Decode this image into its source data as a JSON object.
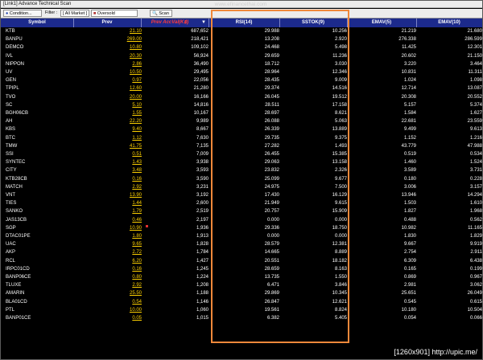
{
  "window": {
    "title": "[Link1] Advance Technical Scan",
    "watermark": "www.efinancethai.com"
  },
  "toolbar": {
    "condition_label": "Condition...",
    "filter_label": "Filter :",
    "filter_value": "[ All Market ]",
    "scan_name": "Oversold",
    "scan_label": "Scan"
  },
  "columns": {
    "symbol": "Symbol",
    "prev": "Prev",
    "prev_acc_val": "Prev AccVal(K฿)",
    "rsi": "RSI(14)",
    "sstok": "SSTOK(9)",
    "emav5": "EMAV(5)",
    "emav10": "EMAV(10)"
  },
  "rows": [
    {
      "symbol": "KTB",
      "prev": "21.10",
      "acc": "687,652",
      "rsi": "29.988",
      "ssto": "10.256",
      "ema5": "21.219",
      "ema10": "21.680"
    },
    {
      "symbol": "BANPU",
      "prev": "269.00",
      "acc": "218,421",
      "rsi": "13.208",
      "ssto": "2.920",
      "ema5": "276.338",
      "ema10": "286.599"
    },
    {
      "symbol": "DEMCO",
      "prev": "10.80",
      "acc": "109,102",
      "rsi": "24.468",
      "ssto": "5.498",
      "ema5": "11.425",
      "ema10": "12.301"
    },
    {
      "symbol": "IVL",
      "prev": "20.30",
      "acc": "56,924",
      "rsi": "29.659",
      "ssto": "11.236",
      "ema5": "20.602",
      "ema10": "21.150"
    },
    {
      "symbol": "NIPPON",
      "prev": "2.86",
      "acc": "36,490",
      "rsi": "18.712",
      "ssto": "3.030",
      "ema5": "3.220",
      "ema10": "3.464"
    },
    {
      "symbol": "UV",
      "prev": "10.50",
      "acc": "29,495",
      "rsi": "28.964",
      "ssto": "12.346",
      "ema5": "10.831",
      "ema10": "11.311"
    },
    {
      "symbol": "GEN",
      "prev": "0.97",
      "acc": "22,056",
      "rsi": "28.435",
      "ssto": "9.009",
      "ema5": "1.024",
      "ema10": "1.098"
    },
    {
      "symbol": "TPIPL",
      "prev": "12.60",
      "acc": "21,280",
      "rsi": "29.374",
      "ssto": "14.516",
      "ema5": "12.714",
      "ema10": "13.087"
    },
    {
      "symbol": "TVO",
      "prev": "20.00",
      "acc": "16,166",
      "rsi": "26.045",
      "ssto": "19.512",
      "ema5": "20.308",
      "ema10": "20.552"
    },
    {
      "symbol": "SC",
      "prev": "5.10",
      "acc": "14,816",
      "rsi": "28.511",
      "ssto": "17.158",
      "ema5": "5.157",
      "ema10": "5.374"
    },
    {
      "symbol": "BGH06CB",
      "prev": "1.55",
      "acc": "10,167",
      "rsi": "28.697",
      "ssto": "8.621",
      "ema5": "1.584",
      "ema10": "1.627"
    },
    {
      "symbol": "AH",
      "prev": "22.20",
      "acc": "9,989",
      "rsi": "26.088",
      "ssto": "5.063",
      "ema5": "22.681",
      "ema10": "23.559"
    },
    {
      "symbol": "KBS",
      "prev": "9.40",
      "acc": "8,667",
      "rsi": "26.339",
      "ssto": "13.889",
      "ema5": "9.499",
      "ema10": "9.613"
    },
    {
      "symbol": "BTC",
      "prev": "1.12",
      "acc": "7,630",
      "rsi": "29.735",
      "ssto": "9.375",
      "ema5": "1.152",
      "ema10": "1.216"
    },
    {
      "symbol": "TMW",
      "prev": "41.75",
      "acc": "7,135",
      "rsi": "27.282",
      "ssto": "1.493",
      "ema5": "43.779",
      "ema10": "47.988"
    },
    {
      "symbol": "SSI",
      "prev": "0.51",
      "acc": "7,009",
      "rsi": "26.455",
      "ssto": "15.385",
      "ema5": "0.519",
      "ema10": "0.534"
    },
    {
      "symbol": "SYNTEC",
      "prev": "1.43",
      "acc": "3,938",
      "rsi": "29.063",
      "ssto": "13.158",
      "ema5": "1.460",
      "ema10": "1.524"
    },
    {
      "symbol": "CITY",
      "prev": "3.48",
      "acc": "3,593",
      "rsi": "23.832",
      "ssto": "2.326",
      "ema5": "3.589",
      "ema10": "3.731"
    },
    {
      "symbol": "KTB28CB",
      "prev": "0.16",
      "acc": "3,590",
      "rsi": "25.099",
      "ssto": "9.677",
      "ema5": "0.180",
      "ema10": "0.228"
    },
    {
      "symbol": "MATCH",
      "prev": "2.92",
      "acc": "3,231",
      "rsi": "24.975",
      "ssto": "7.500",
      "ema5": "3.006",
      "ema10": "3.157"
    },
    {
      "symbol": "VNT",
      "prev": "13.90",
      "acc": "3,192",
      "rsi": "17.430",
      "ssto": "16.129",
      "ema5": "13.946",
      "ema10": "14.294"
    },
    {
      "symbol": "TIES",
      "prev": "1.44",
      "acc": "2,600",
      "rsi": "21.949",
      "ssto": "9.615",
      "ema5": "1.503",
      "ema10": "1.610"
    },
    {
      "symbol": "SANKO",
      "prev": "1.79",
      "acc": "2,519",
      "rsi": "20.757",
      "ssto": "15.909",
      "ema5": "1.827",
      "ema10": "1.968"
    },
    {
      "symbol": "JAS13CB",
      "prev": "0.46",
      "acc": "2,197",
      "rsi": "0.000",
      "ssto": "0.000",
      "ema5": "0.488",
      "ema10": "0.562"
    },
    {
      "symbol": "SGP",
      "prev": "10.90",
      "acc": "1,936",
      "rsi": "29.336",
      "ssto": "18.750",
      "ema5": "10.982",
      "ema10": "11.165"
    },
    {
      "symbol": "DTAC01PE",
      "prev": "1.80",
      "acc": "1,913",
      "rsi": "0.000",
      "ssto": "0.000",
      "ema5": "1.830",
      "ema10": "1.829"
    },
    {
      "symbol": "UAC",
      "prev": "9.65",
      "acc": "1,828",
      "rsi": "28.579",
      "ssto": "12.381",
      "ema5": "9.667",
      "ema10": "9.919"
    },
    {
      "symbol": "AKP",
      "prev": "2.72",
      "acc": "1,784",
      "rsi": "14.665",
      "ssto": "8.889",
      "ema5": "2.754",
      "ema10": "2.911"
    },
    {
      "symbol": "RCL",
      "prev": "6.20",
      "acc": "1,427",
      "rsi": "20.551",
      "ssto": "18.182",
      "ema5": "6.309",
      "ema10": "6.438"
    },
    {
      "symbol": "IRPC01CD",
      "prev": "0.16",
      "acc": "1,245",
      "rsi": "28.659",
      "ssto": "8.163",
      "ema5": "0.165",
      "ema10": "0.199"
    },
    {
      "symbol": "BANP06CE",
      "prev": "0.80",
      "acc": "1,224",
      "rsi": "13.735",
      "ssto": "1.550",
      "ema5": "0.869",
      "ema10": "0.967"
    },
    {
      "symbol": "TLUXE",
      "prev": "2.92",
      "acc": "1,208",
      "rsi": "6.471",
      "ssto": "3.846",
      "ema5": "2.981",
      "ema10": "3.062"
    },
    {
      "symbol": "AMARIN",
      "prev": "25.50",
      "acc": "1,188",
      "rsi": "29.869",
      "ssto": "10.345",
      "ema5": "25.651",
      "ema10": "26.049"
    },
    {
      "symbol": "BLA01CD",
      "prev": "0.54",
      "acc": "1,146",
      "rsi": "26.847",
      "ssto": "12.621",
      "ema5": "0.545",
      "ema10": "0.615"
    },
    {
      "symbol": "PTL",
      "prev": "10.00",
      "acc": "1,060",
      "rsi": "19.561",
      "ssto": "8.824",
      "ema5": "10.180",
      "ema10": "10.504"
    },
    {
      "symbol": "BANP01CE",
      "prev": "0.05",
      "acc": "1,015",
      "rsi": "6.382",
      "ssto": "5.405",
      "ema5": "0.054",
      "ema10": "0.066"
    }
  ],
  "footer": {
    "caption": "[1260x901] http://upic.me/"
  }
}
